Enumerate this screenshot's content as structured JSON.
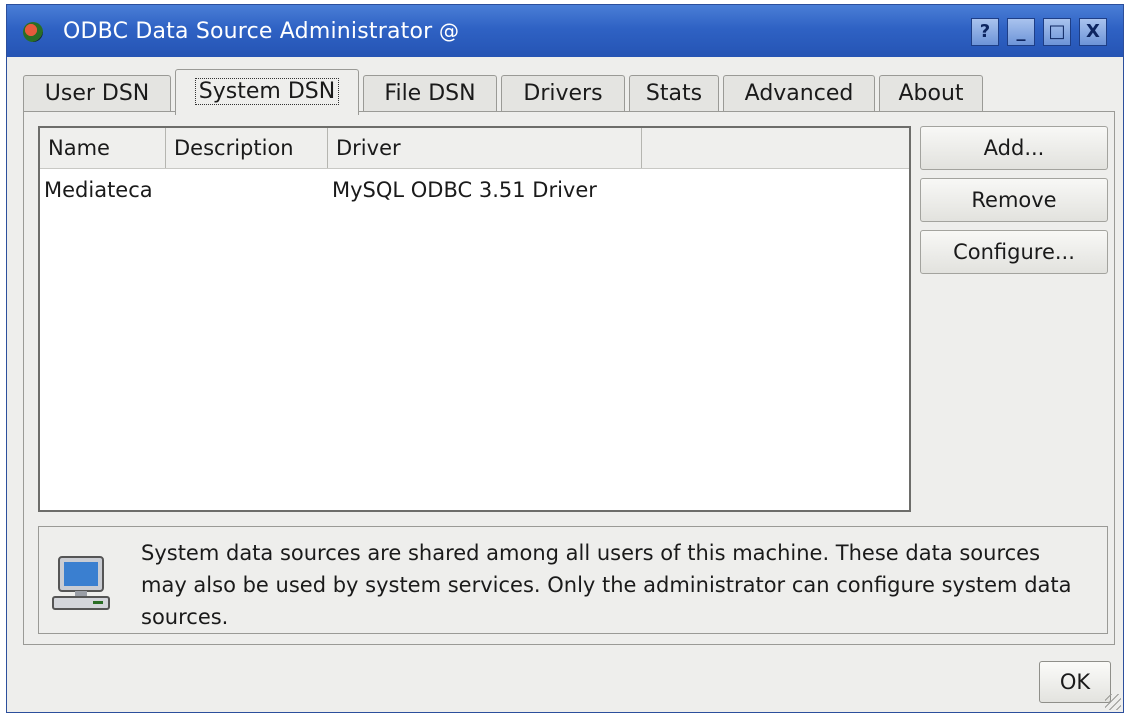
{
  "window": {
    "title": "ODBC Data Source Administrator",
    "controls": {
      "help": "?",
      "minimize": "_",
      "maximize": "□",
      "close": "X"
    },
    "accent_color": "#2f62c4"
  },
  "tabs": [
    {
      "label": "User DSN",
      "active": false
    },
    {
      "label": "System DSN",
      "active": true
    },
    {
      "label": "File DSN",
      "active": false
    },
    {
      "label": "Drivers",
      "active": false
    },
    {
      "label": "Stats",
      "active": false
    },
    {
      "label": "Advanced",
      "active": false
    },
    {
      "label": "About",
      "active": false
    }
  ],
  "list": {
    "columns": [
      "Name",
      "Description",
      "Driver",
      ""
    ],
    "rows": [
      {
        "name": "Mediateca",
        "description": "",
        "driver": "MySQL ODBC 3.51 Driver"
      }
    ]
  },
  "buttons": {
    "add": "Add...",
    "remove": "Remove",
    "configure": "Configure...",
    "ok": "OK"
  },
  "info": {
    "icon": "computer-icon",
    "text": "System data sources are shared among all users of this machine. These data sources may also be used by system services. Only the administrator can configure system data sources."
  }
}
